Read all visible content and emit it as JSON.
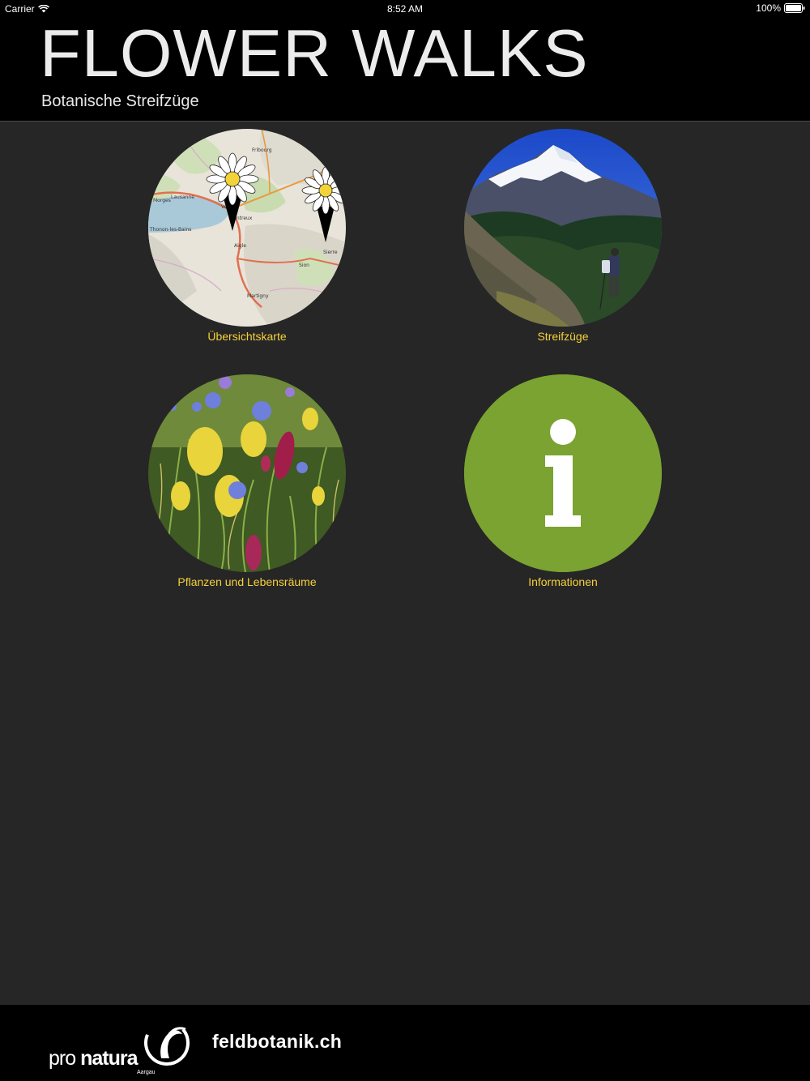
{
  "status_bar": {
    "carrier": "Carrier",
    "time": "8:52 AM",
    "battery": "100%"
  },
  "header": {
    "title": "FLOWER WALKS",
    "subtitle": "Botanische Streifzüge"
  },
  "tiles": [
    {
      "label": "Übersichtskarte",
      "icon": "map-icon"
    },
    {
      "label": "Streifzüge",
      "icon": "hiker-photo"
    },
    {
      "label": "Pflanzen und Lebensräume",
      "icon": "flowers-photo"
    },
    {
      "label": "Informationen",
      "icon": "info-icon"
    }
  ],
  "map_labels": {
    "city_1": "Lausanne",
    "city_2": "Vevey",
    "city_3": "Montreux",
    "city_4": "Aigle",
    "city_5": "Fribourg",
    "city_6": "Sion",
    "city_7": "Martigny",
    "city_8": "Morges",
    "city_9": "Sierre",
    "city_10": "Thonon-les-Bains"
  },
  "footer": {
    "logo_text_light": "pro",
    "logo_text_bold": "natura",
    "logo_sub": "Aargau",
    "link": "feldbotanik.ch"
  },
  "colors": {
    "label": "#f5d13a",
    "info_green": "#7aa331",
    "background": "#262626"
  }
}
